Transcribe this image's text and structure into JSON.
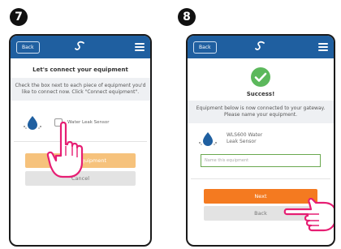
{
  "steps": [
    {
      "number": "7",
      "topbar": {
        "back_label": "Back"
      },
      "title": "Let's connect your equipment",
      "description": "Check the box next to each piece of equipment you'd like to connect now. Click \"Connect equipment\".",
      "device_label": "Water Leak Sensor",
      "connect_button_label": "Connect equipment",
      "cancel_button_label": "Cancel"
    },
    {
      "number": "8",
      "topbar": {
        "back_label": "Back"
      },
      "title": "Success!",
      "description": "Equipment below is now connected to your gateway. Please name your equipment.",
      "device_label": "WLS600 Water Leak Sensor",
      "name_placeholder": "Name this equipment",
      "next_button_label": "Next",
      "back_button_label": "Back"
    }
  ],
  "colors": {
    "topbar": "#1f5fa0",
    "orange": "#f47a20",
    "orange_disabled": "#f6c27c",
    "gray_button": "#e3e3e3",
    "success_green": "#5cb85c",
    "hand_pink": "#e61e73"
  },
  "icons": [
    "salus-logo-icon",
    "menu-icon",
    "water-drop-sensor-icon",
    "success-check-icon",
    "pointing-hand-icon"
  ]
}
